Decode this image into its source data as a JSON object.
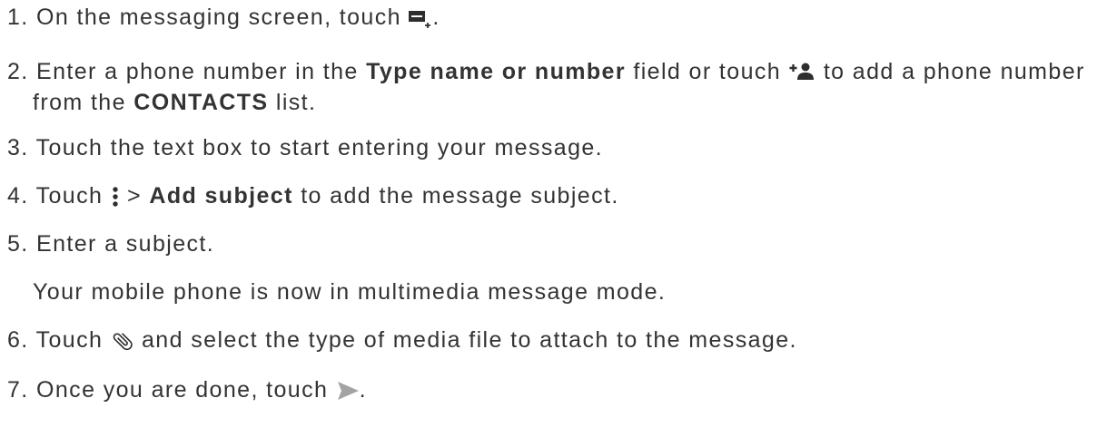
{
  "steps": [
    {
      "number": "1.",
      "text": "On the messaging screen, touch",
      "icon": "new-message-icon",
      "end": "."
    },
    {
      "number": "2.",
      "text_1": "Enter a phone number in the",
      "bold_1": "Type name or number",
      "text_2": "field or touch",
      "icon": "add-contact-icon",
      "text_3": "to add a phone number",
      "text_4": "from the",
      "bold_2": "CONTACTS",
      "text_5": "list."
    },
    {
      "number": "3.",
      "text": "Touch the text box to start entering your message."
    },
    {
      "number": "4.",
      "text_1": "Touch",
      "icon": "more-options-icon",
      "text_2": ">",
      "bold_1": "Add subject",
      "text_3": "to add the message subject."
    },
    {
      "number": "5.",
      "text": "Enter a subject.",
      "note": "Your mobile phone is now in multimedia message mode."
    },
    {
      "number": "6.",
      "text_1": "Touch",
      "icon": "paperclip-icon",
      "text_2": "and select the type of media file to attach to the message."
    },
    {
      "number": "7.",
      "text": "Once you are done, touch",
      "icon": "send-icon",
      "end": "."
    }
  ],
  "colors": {
    "text": "#333333",
    "icon": "#2e2e2e",
    "send_icon": "#a3a3a3"
  }
}
